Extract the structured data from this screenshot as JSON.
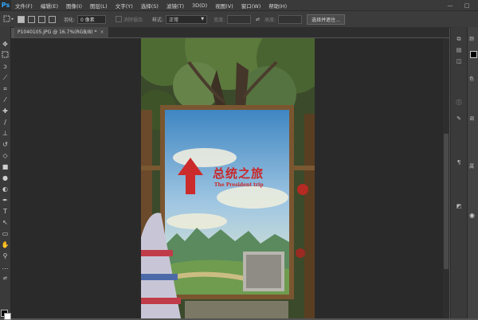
{
  "app": {
    "logo": "Ps"
  },
  "menu": [
    "文件(F)",
    "编辑(E)",
    "图像(I)",
    "图层(L)",
    "文字(Y)",
    "选择(S)",
    "滤镜(T)",
    "3D(D)",
    "视图(V)",
    "窗口(W)",
    "帮助(H)"
  ],
  "window_controls": {
    "minimize": "—",
    "restore": "□"
  },
  "options": {
    "feather_label": "羽化:",
    "feather_value": "0 像素",
    "antialias_label": "消除锯齿",
    "style_label": "样式:",
    "style_value": "正常",
    "width_label": "宽度:",
    "swap": "⇄",
    "height_label": "高度:",
    "select_mask_button": "选择并遮住..."
  },
  "document_tab": {
    "title": "P1040105.JPG @ 16.7%(RGB/8) *",
    "close": "×"
  },
  "photo": {
    "sign_title": "总统之旅",
    "sign_subtitle": "The President trip"
  },
  "tools": [
    "move-tool",
    "marquee-tool",
    "lasso-tool",
    "quick-select-tool",
    "crop-tool",
    "eyedropper-tool",
    "healing-tool",
    "brush-tool",
    "stamp-tool",
    "history-brush-tool",
    "eraser-tool",
    "gradient-tool",
    "blur-tool",
    "dodge-tool",
    "pen-tool",
    "type-tool",
    "path-select-tool",
    "shape-tool",
    "hand-tool",
    "zoom-tool"
  ],
  "right_panel": {
    "labels": [
      "颜",
      "色",
      "调",
      "属"
    ]
  }
}
